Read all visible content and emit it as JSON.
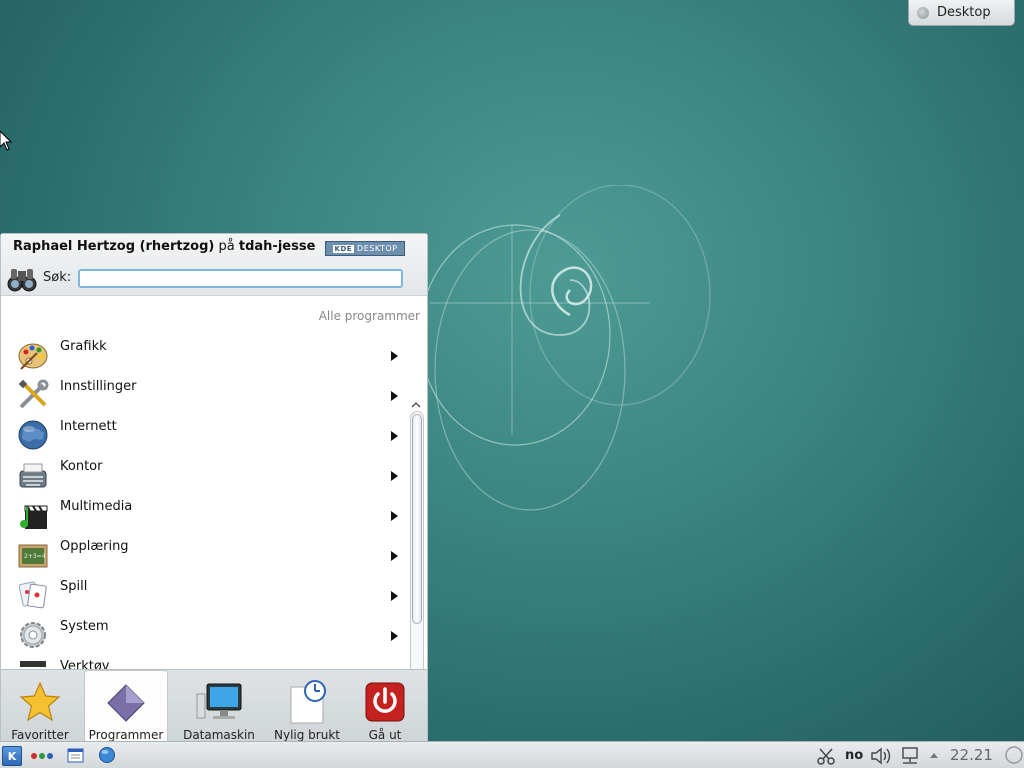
{
  "desktop": {
    "containment_tab_label": "Desktop"
  },
  "launcher": {
    "user_name": "Raphael Hertzog (rhertzog)",
    "user_preposition": "på",
    "host_name": "tdah-jesse",
    "badge_text": "DESKTOP",
    "badge_logo": "KDE",
    "search_label": "Søk:",
    "search_value": "",
    "all_programs_label": "Alle programmer",
    "menu_items": [
      {
        "label": "Grafikk",
        "icon": "palette-icon"
      },
      {
        "label": "Innstillinger",
        "icon": "tools-icon"
      },
      {
        "label": "Internett",
        "icon": "globe-icon"
      },
      {
        "label": "Kontor",
        "icon": "typewriter-icon"
      },
      {
        "label": "Multimedia",
        "icon": "clapperboard-icon"
      },
      {
        "label": "Opplæring",
        "icon": "chalkboard-icon"
      },
      {
        "label": "Spill",
        "icon": "cards-icon"
      },
      {
        "label": "System",
        "icon": "gear-icon"
      },
      {
        "label": "Verktøy",
        "icon": "utilities-icon"
      }
    ],
    "tabs": [
      {
        "label": "Favoritter",
        "icon": "star-icon"
      },
      {
        "label": "Programmer",
        "icon": "diamond-icon"
      },
      {
        "label": "Datamaskin",
        "icon": "monitor-icon"
      },
      {
        "label": "Nylig brukt",
        "icon": "clock-document-icon"
      },
      {
        "label": "Gå ut",
        "icon": "power-icon"
      }
    ],
    "active_tab": "Programmer"
  },
  "taskbar": {
    "kmenu_glyph": "K",
    "keyboard_layout": "no",
    "clock": "22.21"
  },
  "colors": {
    "desktop_bg": "#3b8582",
    "search_border": "#7fb6e0",
    "power_red": "#c4221f",
    "star_yellow": "#f4c130"
  }
}
